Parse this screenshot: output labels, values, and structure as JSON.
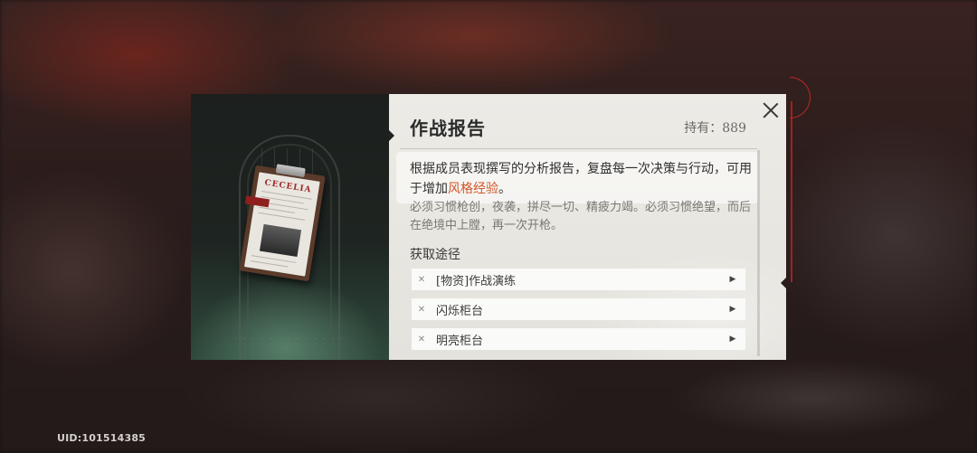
{
  "footer": {
    "uid": "UID:101514385"
  },
  "item": {
    "name": "作战报告",
    "owned": "持有：889",
    "description_prefix": "根据成员表现撰写的分析报告，复盘每一次决策与行动，可用于增加",
    "description_highlight": "风格经验",
    "description_suffix": "。",
    "flavor": "必须习惯枪创，夜袭，拼尽一切、精疲力竭。必须习惯绝望，而后在绝境中上膛，再一次开枪。",
    "art_title": "CECELIA"
  },
  "sources": {
    "label": "获取途径",
    "items": [
      {
        "label": "[物资]作战演练"
      },
      {
        "label": "闪烁柜台"
      },
      {
        "label": "明亮柜台"
      }
    ]
  },
  "colors": {
    "highlight": "#d2562a",
    "accent": "#c42828"
  },
  "icons": {
    "close": "close-icon",
    "row_arrow": "play-arrow-icon",
    "row_bullet": "cross-bullet-icon"
  }
}
